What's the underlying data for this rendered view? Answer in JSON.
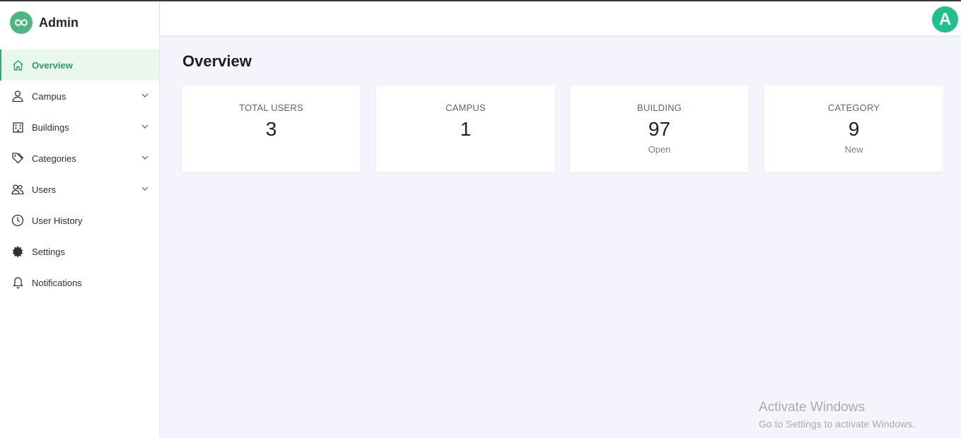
{
  "brand": {
    "name": "Admin",
    "logo_icon": "infinity-icon",
    "logo_color": "#4cb783"
  },
  "sidebar": {
    "items": [
      {
        "label": "Overview",
        "icon": "home-icon",
        "active": true
      },
      {
        "label": "Campus",
        "icon": "user-pin-icon",
        "expandable": true
      },
      {
        "label": "Buildings",
        "icon": "building-icon",
        "expandable": true
      },
      {
        "label": "Categories",
        "icon": "tags-icon",
        "expandable": true
      },
      {
        "label": "Users",
        "icon": "users-icon",
        "expandable": true
      },
      {
        "label": "User History",
        "icon": "clock-icon"
      },
      {
        "label": "Settings",
        "icon": "gear-icon"
      },
      {
        "label": "Notifications",
        "icon": "bell-icon"
      }
    ]
  },
  "header": {
    "avatar_letter": "A",
    "avatar_color": "#1fc08e"
  },
  "main": {
    "title": "Overview",
    "cards": [
      {
        "title": "TOTAL USERS",
        "value": "3",
        "sub": ""
      },
      {
        "title": "CAMPUS",
        "value": "1",
        "sub": ""
      },
      {
        "title": "BUILDING",
        "value": "97",
        "sub": "Open"
      },
      {
        "title": "CATEGORY",
        "value": "9",
        "sub": "New"
      }
    ]
  },
  "watermark": {
    "title": "Activate Windows",
    "subtitle": "Go to Settings to activate Windows."
  },
  "colors": {
    "accent": "#2a9d62",
    "active_bg": "#e9f7ef",
    "page_bg": "#f4f5fc"
  }
}
